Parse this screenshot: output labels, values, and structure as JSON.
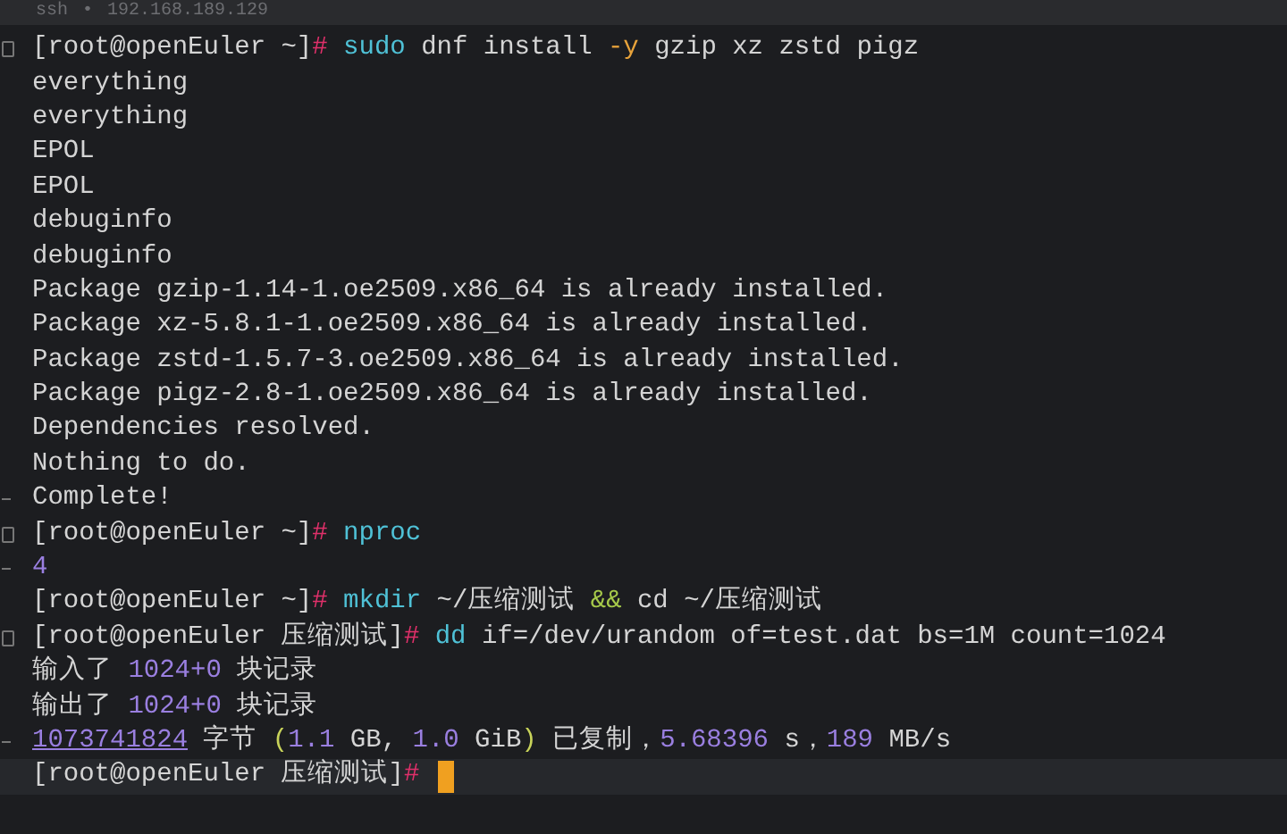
{
  "tab": {
    "protocol": "ssh",
    "separator": "•",
    "host": "192.168.189.129"
  },
  "lines": [
    {
      "fold_start": true,
      "segments": [
        {
          "text": "[root@openEuler ~]",
          "color": "#d4d4d4"
        },
        {
          "text": "# ",
          "color": "#e0306a"
        },
        {
          "text": "sudo ",
          "color": "#4fc1d6"
        },
        {
          "text": "dnf install ",
          "color": "#d4d4d4"
        },
        {
          "text": "-y",
          "color": "#e8a33b"
        },
        {
          "text": " gzip xz zstd pigz",
          "color": "#d4d4d4"
        }
      ]
    },
    {
      "segments": [
        {
          "text": "everything",
          "color": "#d4d4d4"
        }
      ]
    },
    {
      "segments": [
        {
          "text": "everything",
          "color": "#d4d4d4"
        }
      ]
    },
    {
      "segments": [
        {
          "text": "EPOL",
          "color": "#d4d4d4"
        }
      ]
    },
    {
      "segments": [
        {
          "text": "EPOL",
          "color": "#d4d4d4"
        }
      ]
    },
    {
      "segments": [
        {
          "text": "debuginfo",
          "color": "#d4d4d4"
        }
      ]
    },
    {
      "segments": [
        {
          "text": "debuginfo",
          "color": "#d4d4d4"
        }
      ]
    },
    {
      "segments": [
        {
          "text": "Package gzip-1.14-1.oe2509.x86_64 is already installed.",
          "color": "#d4d4d4"
        }
      ]
    },
    {
      "segments": [
        {
          "text": "Package xz-5.8.1-1.oe2509.x86_64 is already installed.",
          "color": "#d4d4d4"
        }
      ]
    },
    {
      "segments": [
        {
          "text": "Package zstd-1.5.7-3.oe2509.x86_64 is already installed.",
          "color": "#d4d4d4"
        }
      ]
    },
    {
      "segments": [
        {
          "text": "Package pigz-2.8-1.oe2509.x86_64 is already installed.",
          "color": "#d4d4d4"
        }
      ]
    },
    {
      "segments": [
        {
          "text": "Dependencies resolved.",
          "color": "#d4d4d4"
        }
      ]
    },
    {
      "segments": [
        {
          "text": "Nothing to do.",
          "color": "#d4d4d4"
        }
      ]
    },
    {
      "fold_end": true,
      "segments": [
        {
          "text": "Complete!",
          "color": "#d4d4d4"
        }
      ]
    },
    {
      "fold_start": true,
      "segments": [
        {
          "text": "[root@openEuler ~]",
          "color": "#d4d4d4"
        },
        {
          "text": "# ",
          "color": "#e0306a"
        },
        {
          "text": "nproc",
          "color": "#4fc1d6"
        }
      ]
    },
    {
      "fold_end": true,
      "segments": [
        {
          "text": "4",
          "color": "#9a7fe0"
        }
      ]
    },
    {
      "segments": [
        {
          "text": "[root@openEuler ~]",
          "color": "#d4d4d4"
        },
        {
          "text": "# ",
          "color": "#e0306a"
        },
        {
          "text": "mkdir ",
          "color": "#4fc1d6"
        },
        {
          "text": "~/压缩测试 ",
          "color": "#d4d4d4"
        },
        {
          "text": "&&",
          "color": "#a6c94a"
        },
        {
          "text": " cd ~/压缩测试",
          "color": "#d4d4d4"
        }
      ]
    },
    {
      "fold_start": true,
      "segments": [
        {
          "text": "[root@openEuler 压缩测试]",
          "color": "#d4d4d4"
        },
        {
          "text": "# ",
          "color": "#e0306a"
        },
        {
          "text": "dd ",
          "color": "#4fc1d6"
        },
        {
          "text": "if=/dev/urandom of=test.dat bs=1M count=1024",
          "color": "#d4d4d4"
        }
      ]
    },
    {
      "segments": [
        {
          "text": "输入了 ",
          "color": "#d4d4d4"
        },
        {
          "text": "1024+0",
          "color": "#9a7fe0"
        },
        {
          "text": " 块记录",
          "color": "#d4d4d4"
        }
      ]
    },
    {
      "segments": [
        {
          "text": "输出了 ",
          "color": "#d4d4d4"
        },
        {
          "text": "1024+0",
          "color": "#9a7fe0"
        },
        {
          "text": " 块记录",
          "color": "#d4d4d4"
        }
      ]
    },
    {
      "fold_end": true,
      "segments": [
        {
          "text": "1073741824",
          "color": "#9a7fe0",
          "underline": true
        },
        {
          "text": " 字节 ",
          "color": "#d4d4d4"
        },
        {
          "text": "(",
          "color": "#c8d35a"
        },
        {
          "text": "1.1",
          "color": "#9a7fe0"
        },
        {
          "text": " GB, ",
          "color": "#d4d4d4"
        },
        {
          "text": "1.0",
          "color": "#9a7fe0"
        },
        {
          "text": " GiB",
          "color": "#d4d4d4"
        },
        {
          "text": ")",
          "color": "#c8d35a"
        },
        {
          "text": " 已复制，",
          "color": "#d4d4d4"
        },
        {
          "text": "5.68396",
          "color": "#9a7fe0"
        },
        {
          "text": " s，",
          "color": "#d4d4d4"
        },
        {
          "text": "189",
          "color": "#9a7fe0"
        },
        {
          "text": " MB/s",
          "color": "#d4d4d4"
        }
      ]
    },
    {
      "current": true,
      "cursor": true,
      "segments": [
        {
          "text": "[root@openEuler 压缩测试]",
          "color": "#d4d4d4"
        },
        {
          "text": "#",
          "color": "#e0306a"
        }
      ]
    }
  ]
}
